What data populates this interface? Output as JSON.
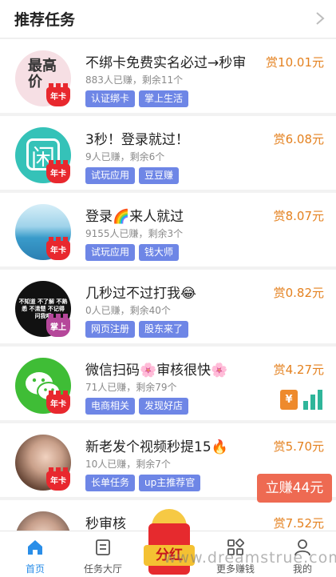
{
  "header": {
    "title": "推荐任务"
  },
  "tasks": [
    {
      "title": "不绑卡免费实名必过→秒审",
      "reward": "赏10.01元",
      "meta": "883人已赚，剩余11个",
      "tags": [
        "认证绑卡",
        "掌上生活"
      ],
      "badge": "年卡",
      "avatar_text": "最高价"
    },
    {
      "title": "3秒！登录就过！",
      "reward": "赏6.08元",
      "meta": "9人已赚，剩余6个",
      "tags": [
        "试玩应用",
        "豆豆赚"
      ],
      "badge": "年卡",
      "avatar_text": "闲"
    },
    {
      "title": "登录🌈来人就过",
      "reward": "赏8.07元",
      "meta": "9155人已赚，剩余3个",
      "tags": [
        "试玩应用",
        "钱大师"
      ],
      "badge": "年卡",
      "avatar_text": ""
    },
    {
      "title": "几秒过不过打我😂",
      "reward": "赏0.82元",
      "meta": "0人已赚，剩余40个",
      "tags": [
        "网页注册",
        "股东来了"
      ],
      "badge": "掌上",
      "avatar_text": "不知道 不了解 不熟悉 不清楚 不记得 问我吧"
    },
    {
      "title": "微信扫码🌸审核很快🌸",
      "reward": "赏4.27元",
      "meta": "71人已赚，剩余79个",
      "tags": [
        "电商相关",
        "发现好店"
      ],
      "badge": "年卡",
      "avatar_text": ""
    },
    {
      "title": "新老发个视频秒提15🔥",
      "reward": "赏5.70元",
      "meta": "10人已赚，剩余7个",
      "tags": [
        "长单任务",
        "up主推荐官"
      ],
      "badge": "年卡",
      "avatar_text": ""
    },
    {
      "title": "秒审核",
      "reward": "赏7.52元",
      "meta": "",
      "tags": [],
      "badge": "",
      "avatar_text": ""
    }
  ],
  "side_icons": {
    "currency": "¥"
  },
  "float_button": {
    "label": "立赚44元"
  },
  "redpack": {
    "label": "分红"
  },
  "tabbar": [
    {
      "label": "首页",
      "icon": "home-icon",
      "active": true
    },
    {
      "label": "任务大厅",
      "icon": "task-hall-icon",
      "active": false
    },
    {
      "label": "分红",
      "icon": "redpack-icon",
      "active": false
    },
    {
      "label": "更多赚钱",
      "icon": "grid-icon",
      "active": false
    },
    {
      "label": "我的",
      "icon": "user-icon",
      "active": false
    }
  ],
  "watermark": "www.dreamstrue.com",
  "colors": {
    "reward": "#e4811f",
    "tag": "#6e86e6",
    "active": "#2a8ee8",
    "float": "#ee6a52"
  }
}
